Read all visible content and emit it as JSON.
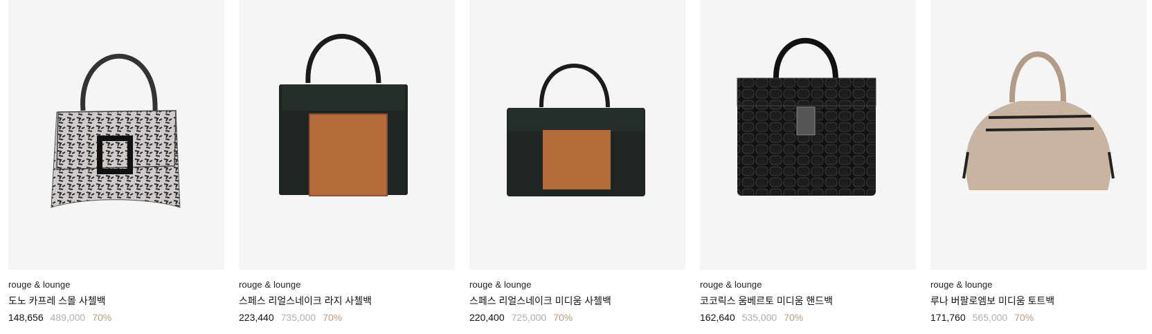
{
  "products": [
    {
      "brand": "rouge & lounge",
      "name": "도노 카프레 스몰 사첼백",
      "price": "148,656",
      "original_price": "489,000",
      "discount": "70%",
      "image_icon": "snakeskin-handbag-image"
    },
    {
      "brand": "rouge & lounge",
      "name": "스페스 리얼스네이크 라지 사첼백",
      "price": "223,440",
      "original_price": "735,000",
      "discount": "70%",
      "image_icon": "black-tan-satchel-large-image"
    },
    {
      "brand": "rouge & lounge",
      "name": "스페스 리얼스네이크 미디움 사첼백",
      "price": "220,400",
      "original_price": "725,000",
      "discount": "70%",
      "image_icon": "black-tan-satchel-medium-image"
    },
    {
      "brand": "rouge & lounge",
      "name": "코코릭스 움베르토 미디움 핸드백",
      "price": "162,640",
      "original_price": "535,000",
      "discount": "70%",
      "image_icon": "black-croc-handbag-image"
    },
    {
      "brand": "rouge & lounge",
      "name": "루나 버팔로엠보 미디움 토트백",
      "price": "171,760",
      "original_price": "565,000",
      "discount": "70%",
      "image_icon": "beige-tote-image"
    }
  ],
  "colors": {
    "price": "#111111",
    "original_price": "#b0b0b0",
    "discount": "#c49a78",
    "thumb_bg": "#f5f5f5"
  }
}
